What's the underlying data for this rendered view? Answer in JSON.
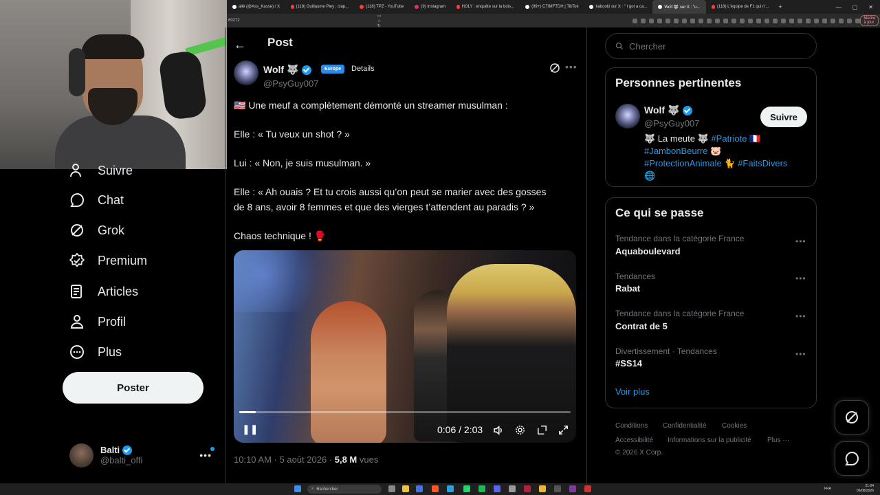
{
  "browser": {
    "tabs": [
      {
        "label": "allé (@Ass_Kasse) / X",
        "color": "#ffffff"
      },
      {
        "label": "(118) Guillaume Pley : clap...",
        "color": "#ff3b3b"
      },
      {
        "label": "(118) TPZ - YouTube",
        "color": "#ff3b3b"
      },
      {
        "label": "(9) Instagram",
        "color": "#e1306c"
      },
      {
        "label": "HOLY : enquête sur la bois...",
        "color": "#ff3b3b"
      },
      {
        "label": "(99+) CTIMFTDH | TikTok",
        "color": "#ffffff"
      },
      {
        "label": "kabooki sur X : \" I got a ca...",
        "color": "#ffffff"
      },
      {
        "label": "Wolf 🐺 sur X : \"u...",
        "color": "#ffffff",
        "active": true
      },
      {
        "label": "(118) L'équipe de F1 qui n'...",
        "color": "#ff3b3b"
      }
    ],
    "address": "60272",
    "update_button": "Mettre à jour"
  },
  "nav": {
    "partial_item": "Suivre",
    "items": [
      {
        "label": "Chat",
        "icon": "chat-icon"
      },
      {
        "label": "Grok",
        "icon": "grok-icon"
      },
      {
        "label": "Premium",
        "icon": "premium-icon"
      },
      {
        "label": "Articles",
        "icon": "articles-icon"
      },
      {
        "label": "Profil",
        "icon": "profile-icon"
      },
      {
        "label": "Plus",
        "icon": "more-circle-icon"
      }
    ],
    "post_button": "Poster",
    "account": {
      "name": "Balti",
      "handle": "@balti_offi"
    }
  },
  "post": {
    "header_title": "Post",
    "author": {
      "name": "Wolf 🐺",
      "handle": "@PsyGuy007",
      "badge": "Europe",
      "details": "Details"
    },
    "lines": [
      "🇺🇸 Une meuf a complètement démonté un streamer musulman :",
      "Elle : « Tu veux un shot ? »",
      "Lui : « Non, je suis musulman. »",
      "Elle : « Ah ouais ? Et tu crois aussi qu’on peut se marier avec des gosses",
      "de 8 ans, avoir 8 femmes et que des vierges t’attendent au paradis ? »",
      "Chaos technique ! 🥊"
    ],
    "video": {
      "time": "0:06 / 2:03",
      "progress": 0.05
    },
    "meta": {
      "time": "10:10 AM",
      "date": "5 août 2026",
      "views_count": "5,8 M",
      "views_label": "vues"
    }
  },
  "sidebar": {
    "search_placeholder": "Chercher",
    "relevant": {
      "title": "Personnes pertinentes",
      "name": "Wolf 🐺",
      "handle": "@PsyGuy007",
      "follow": "Suivre",
      "bio_prefix": "🐺 La meute 🐺",
      "bio_tags": [
        "#Patriote",
        "🇫🇷",
        "#JambonBeurre",
        "🐷",
        "#ProtectionAnimale",
        "🐈",
        "#FaitsDivers",
        "🌐"
      ]
    },
    "happening": {
      "title": "Ce qui se passe",
      "trends": [
        {
          "category": "Tendance dans la catégorie France",
          "name": "Aquaboulevard"
        },
        {
          "category": "Tendances",
          "name": "Rabat"
        },
        {
          "category": "Tendance dans la catégorie France",
          "name": "Contrat de 5"
        },
        {
          "category": "Divertissement · Tendances",
          "name": "#SS14"
        }
      ],
      "see_more": "Voir plus"
    },
    "footer": {
      "links": [
        "Conditions",
        "Confidentialité",
        "Cookies",
        "Accessibilité",
        "Informations sur la publicité",
        "Plus ···"
      ],
      "copyright": "© 2026 X Corp."
    }
  },
  "taskbar": {
    "search": "Rechercher",
    "lang": "FRA",
    "time": "21:04",
    "date": "06/08/2026"
  }
}
